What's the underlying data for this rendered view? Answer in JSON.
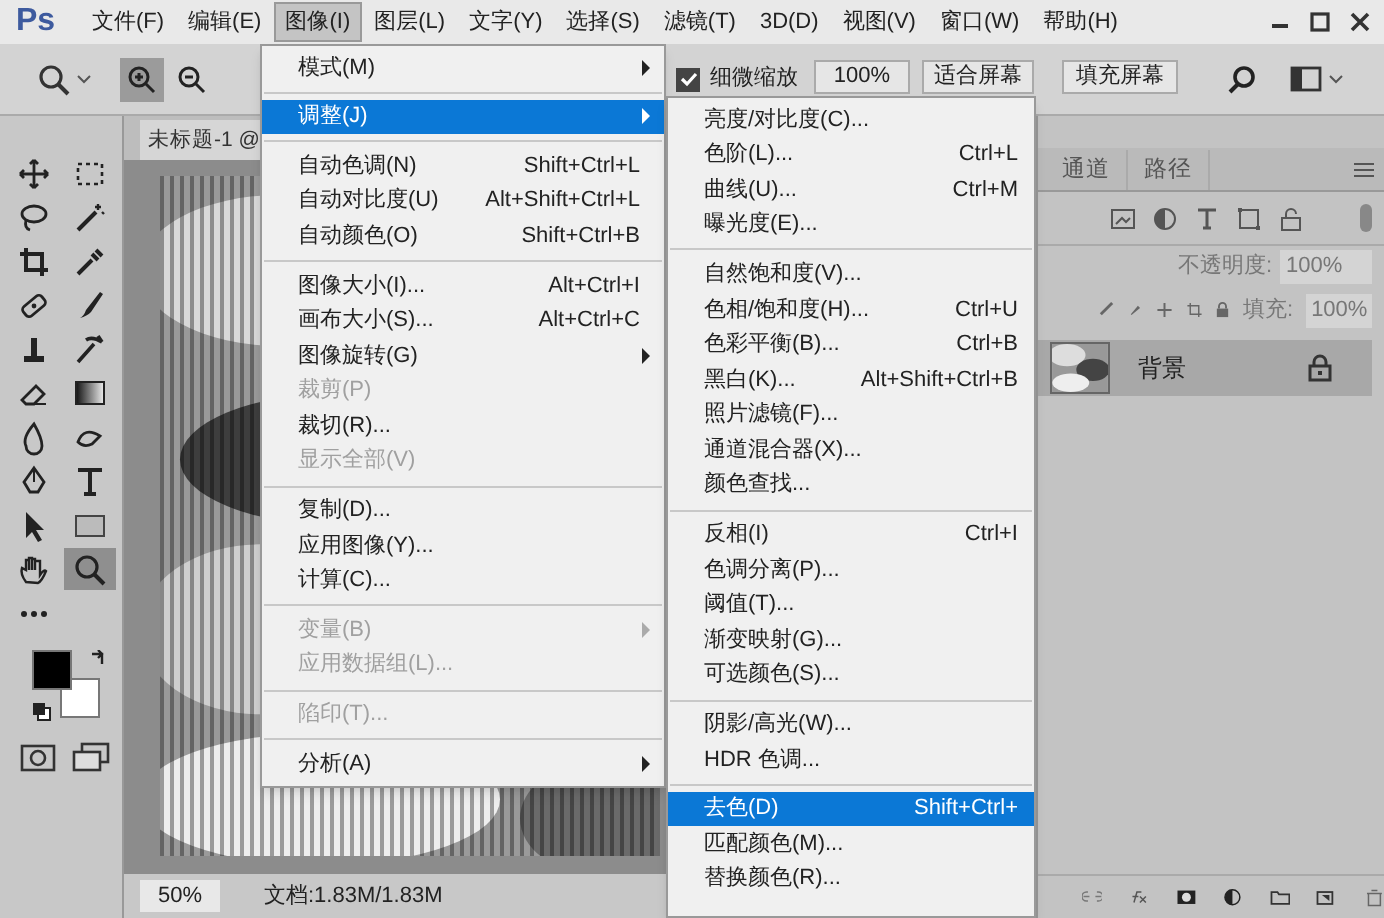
{
  "app": {
    "logo": "Ps"
  },
  "menubar": [
    {
      "label": "文件(F)",
      "selected": false
    },
    {
      "label": "编辑(E)",
      "selected": false
    },
    {
      "label": "图像(I)",
      "selected": true
    },
    {
      "label": "图层(L)",
      "selected": false
    },
    {
      "label": "文字(Y)",
      "selected": false
    },
    {
      "label": "选择(S)",
      "selected": false
    },
    {
      "label": "滤镜(T)",
      "selected": false
    },
    {
      "label": "3D(D)",
      "selected": false
    },
    {
      "label": "视图(V)",
      "selected": false
    },
    {
      "label": "窗口(W)",
      "selected": false
    },
    {
      "label": "帮助(H)",
      "selected": false
    }
  ],
  "options_bar": {
    "zoom_in_pressed": true,
    "fine_zoom": {
      "label": "细微缩放",
      "checked": true
    },
    "buttons": [
      "100%",
      "适合屏幕",
      "填充屏幕"
    ]
  },
  "toolbar": {
    "tools": [
      {
        "selected": false
      },
      {
        "selected": false
      },
      {
        "selected": false
      },
      {
        "selected": false
      },
      {
        "selected": false
      },
      {
        "selected": false
      },
      {
        "selected": false
      },
      {
        "selected": false
      },
      {
        "selected": false
      },
      {
        "selected": false
      },
      {
        "selected": false
      },
      {
        "selected": false
      },
      {
        "selected": false
      },
      {
        "selected": false
      },
      {
        "selected": false
      },
      {
        "selected": false
      },
      {
        "selected": false
      },
      {
        "selected": false
      },
      {
        "selected": false
      },
      {
        "selected": true
      },
      {
        "selected": false
      }
    ]
  },
  "document": {
    "tab": "未标题-1 @",
    "zoom": "50%",
    "doc_info": "文档:1.83M/1.83M"
  },
  "panels": {
    "tabs": [
      {
        "label": "通道",
        "selected": false
      },
      {
        "label": "路径",
        "selected": false
      }
    ],
    "opacity": {
      "label": "不透明度:",
      "value": "100%"
    },
    "fill": {
      "label": "填充:",
      "value": "100%"
    },
    "layers": [
      {
        "name": "背景",
        "selected": true,
        "locked": true
      }
    ]
  },
  "image_menu": {
    "groups": [
      [
        {
          "label": "模式(M)",
          "submenu": true,
          "disabled": false,
          "selected": false
        }
      ],
      [
        {
          "label": "调整(J)",
          "submenu": true,
          "disabled": false,
          "selected": true
        }
      ],
      [
        {
          "label": "自动色调(N)",
          "shortcut": "Shift+Ctrl+L",
          "submenu": false,
          "disabled": false,
          "selected": false
        },
        {
          "label": "自动对比度(U)",
          "shortcut": "Alt+Shift+Ctrl+L",
          "submenu": false,
          "disabled": false,
          "selected": false
        },
        {
          "label": "自动颜色(O)",
          "shortcut": "Shift+Ctrl+B",
          "submenu": false,
          "disabled": false,
          "selected": false
        }
      ],
      [
        {
          "label": "图像大小(I)...",
          "shortcut": "Alt+Ctrl+I",
          "submenu": false,
          "disabled": false,
          "selected": false
        },
        {
          "label": "画布大小(S)...",
          "shortcut": "Alt+Ctrl+C",
          "submenu": false,
          "disabled": false,
          "selected": false
        },
        {
          "label": "图像旋转(G)",
          "submenu": true,
          "disabled": false,
          "selected": false
        },
        {
          "label": "裁剪(P)",
          "submenu": false,
          "disabled": true,
          "selected": false
        },
        {
          "label": "裁切(R)...",
          "submenu": false,
          "disabled": false,
          "selected": false
        },
        {
          "label": "显示全部(V)",
          "submenu": false,
          "disabled": true,
          "selected": false
        }
      ],
      [
        {
          "label": "复制(D)...",
          "submenu": false,
          "disabled": false,
          "selected": false
        },
        {
          "label": "应用图像(Y)...",
          "submenu": false,
          "disabled": false,
          "selected": false
        },
        {
          "label": "计算(C)...",
          "submenu": false,
          "disabled": false,
          "selected": false
        }
      ],
      [
        {
          "label": "变量(B)",
          "submenu": true,
          "disabled": true,
          "selected": false
        },
        {
          "label": "应用数据组(L)...",
          "submenu": false,
          "disabled": true,
          "selected": false
        }
      ],
      [
        {
          "label": "陷印(T)...",
          "submenu": false,
          "disabled": true,
          "selected": false
        }
      ],
      [
        {
          "label": "分析(A)",
          "submenu": true,
          "disabled": false,
          "selected": false
        }
      ]
    ]
  },
  "adjust_submenu": {
    "groups": [
      [
        {
          "label": "亮度/对比度(C)...",
          "selected": false
        },
        {
          "label": "色阶(L)...",
          "shortcut": "Ctrl+L",
          "selected": false
        },
        {
          "label": "曲线(U)...",
          "shortcut": "Ctrl+M",
          "selected": false
        },
        {
          "label": "曝光度(E)...",
          "selected": false
        }
      ],
      [
        {
          "label": "自然饱和度(V)...",
          "selected": false
        },
        {
          "label": "色相/饱和度(H)...",
          "shortcut": "Ctrl+U",
          "selected": false
        },
        {
          "label": "色彩平衡(B)...",
          "shortcut": "Ctrl+B",
          "selected": false
        },
        {
          "label": "黑白(K)...",
          "shortcut": "Alt+Shift+Ctrl+B",
          "selected": false
        },
        {
          "label": "照片滤镜(F)...",
          "selected": false
        },
        {
          "label": "通道混合器(X)...",
          "selected": false
        },
        {
          "label": "颜色查找...",
          "selected": false
        }
      ],
      [
        {
          "label": "反相(I)",
          "shortcut": "Ctrl+I",
          "selected": false
        },
        {
          "label": "色调分离(P)...",
          "selected": false
        },
        {
          "label": "阈值(T)...",
          "selected": false
        },
        {
          "label": "渐变映射(G)...",
          "selected": false
        },
        {
          "label": "可选颜色(S)...",
          "selected": false
        }
      ],
      [
        {
          "label": "阴影/高光(W)...",
          "selected": false
        },
        {
          "label": "HDR 色调...",
          "selected": false
        }
      ],
      [
        {
          "label": "去色(D)",
          "shortcut": "Shift+Ctrl+",
          "selected": true
        },
        {
          "label": "匹配颜色(M)...",
          "selected": false
        },
        {
          "label": "替换颜色(R)...",
          "selected": false
        }
      ]
    ]
  }
}
